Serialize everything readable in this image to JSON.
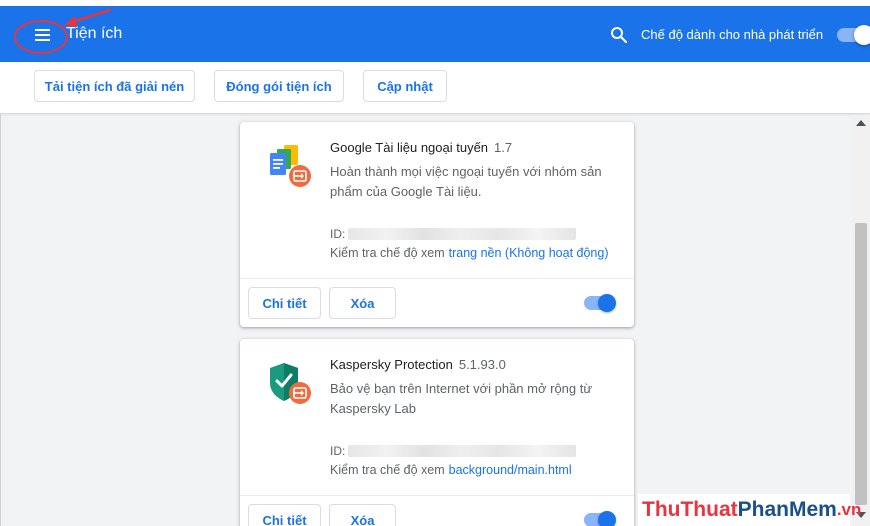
{
  "header": {
    "title": "Tiện ích",
    "developer_mode_label": "Chế độ dành cho nhà phát triển",
    "developer_mode_on": true,
    "color": "#1a73e8"
  },
  "toolbar": {
    "load_unpacked": "Tải tiện ích đã giải nén",
    "pack_extension": "Đóng gói tiện ích",
    "update": "Cập nhật"
  },
  "extensions": [
    {
      "name": "Google Tài liệu ngoại tuyến",
      "version": "1.7",
      "description": "Hoàn thành mọi việc ngoại tuyến với nhóm sản phẩm của Google Tài liệu.",
      "id_label": "ID:",
      "inspect_label": "Kiểm tra chế độ xem",
      "inspect_link": "trang nền (Không hoạt động)",
      "details_label": "Chi tiết",
      "remove_label": "Xóa",
      "enabled": true,
      "icon": "google-docs-offline-icon"
    },
    {
      "name": "Kaspersky Protection",
      "version": "5.1.93.0",
      "description": "Bảo vệ bạn trên Internet với phần mở rộng từ Kaspersky Lab",
      "id_label": "ID:",
      "inspect_label": "Kiểm tra chế độ xem",
      "inspect_link": "background/main.html",
      "details_label": "Chi tiết",
      "remove_label": "Xóa",
      "enabled": true,
      "icon": "kaspersky-shield-icon"
    }
  ],
  "watermark": {
    "part1": "ThuThuat",
    "part2": "PhanMem",
    "part3": ".vn"
  }
}
